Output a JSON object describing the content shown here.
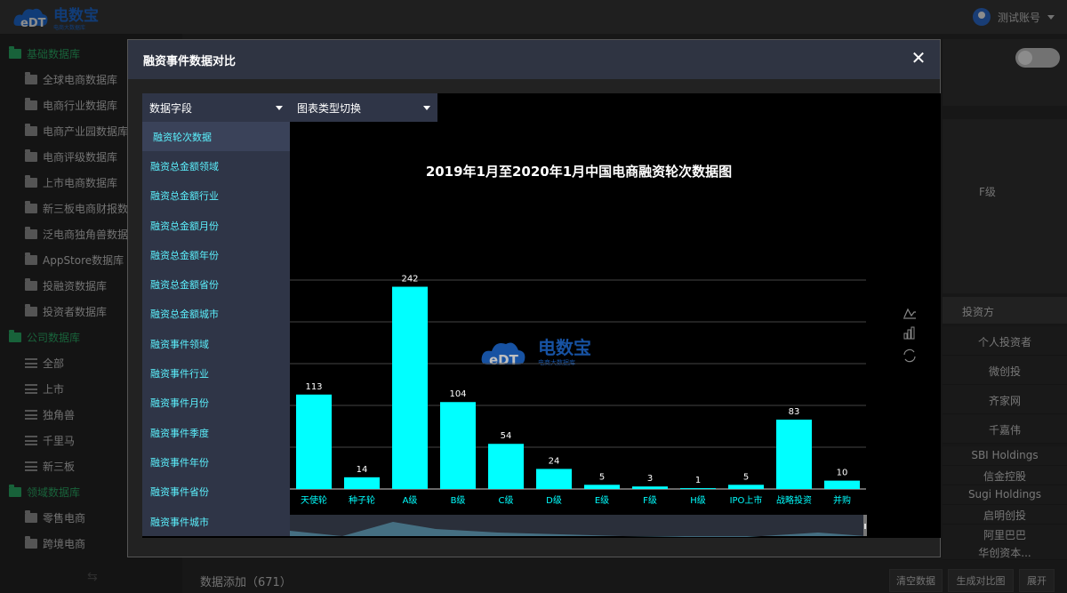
{
  "header": {
    "logo_main": "电数宝",
    "logo_sub": "电商大数据库",
    "user_name": "测试账号"
  },
  "sidebar": {
    "items": [
      {
        "label": "基础数据库",
        "kind": "cat",
        "icon": "folder-icon"
      },
      {
        "label": "全球电商数据库",
        "kind": "sub",
        "icon": "folder-icon"
      },
      {
        "label": "电商行业数据库",
        "kind": "sub",
        "icon": "folder-icon"
      },
      {
        "label": "电商产业园数据库",
        "kind": "sub",
        "icon": "folder-icon"
      },
      {
        "label": "电商评级数据库",
        "kind": "sub",
        "icon": "folder-icon"
      },
      {
        "label": "上市电商数据库",
        "kind": "sub",
        "icon": "folder-icon"
      },
      {
        "label": "新三板电商财报数",
        "kind": "sub",
        "icon": "folder-icon"
      },
      {
        "label": "泛电商独角兽数据",
        "kind": "sub",
        "icon": "folder-icon"
      },
      {
        "label": "AppStore数据库",
        "kind": "sub",
        "icon": "folder-icon"
      },
      {
        "label": "投融资数据库",
        "kind": "sub",
        "icon": "folder-icon"
      },
      {
        "label": "投资者数据库",
        "kind": "sub",
        "icon": "folder-icon"
      },
      {
        "label": "公司数据库",
        "kind": "cat",
        "icon": "folder-icon"
      },
      {
        "label": "全部",
        "kind": "sub",
        "icon": "list-icon"
      },
      {
        "label": "上市",
        "kind": "sub",
        "icon": "list-icon"
      },
      {
        "label": "独角兽",
        "kind": "sub",
        "icon": "list-icon"
      },
      {
        "label": "千里马",
        "kind": "sub",
        "icon": "list-icon"
      },
      {
        "label": "新三板",
        "kind": "sub",
        "icon": "list-icon"
      },
      {
        "label": "领域数据库",
        "kind": "cat",
        "icon": "folder-icon"
      },
      {
        "label": "零售电商",
        "kind": "sub",
        "icon": "folder-icon"
      },
      {
        "label": "跨境电商",
        "kind": "sub",
        "icon": "folder-icon"
      }
    ],
    "collapse_glyph": "⇆"
  },
  "right_panel": {
    "f_level": "F级",
    "investor_header": "投资方",
    "investors": [
      "个人投资者",
      "微创投",
      "齐家网",
      "千嘉伟",
      "SBI Holdings",
      "信金控股",
      "Sugi Holdings",
      "启明创投",
      "阿里巴巴",
      "华创资本..."
    ]
  },
  "bottom_bar": {
    "data_add": "数据添加（671）",
    "clear_button": "清空数据",
    "compare_button": "生成对比图",
    "expand_button": "展开"
  },
  "modal": {
    "title": "融资事件数据对比",
    "close_glyph": "✕",
    "field_dropdown": "数据字段",
    "charttype_dropdown": "图表类型切换",
    "menu_items": [
      "融资轮次数据",
      "融资总金额领域",
      "融资总金额行业",
      "融资总金额月份",
      "融资总金额年份",
      "融资总金额省份",
      "融资总金额城市",
      "融资事件领域",
      "融资事件行业",
      "融资事件月份",
      "融资事件季度",
      "融资事件年份",
      "融资事件省份",
      "融资事件城市"
    ],
    "active_menu_index": 0
  },
  "chart_data": {
    "type": "bar",
    "title": "2019年1月至2020年1月中国电商融资轮次数据图",
    "categories": [
      "天使轮",
      "种子轮",
      "A级",
      "B级",
      "C级",
      "D级",
      "E级",
      "F级",
      "H级",
      "IPO上市",
      "战略投资",
      "并购"
    ],
    "values": [
      113,
      14,
      242,
      104,
      54,
      24,
      5,
      3,
      1,
      5,
      83,
      10
    ],
    "xlabel": "",
    "ylabel": "",
    "ylim": [
      0,
      250
    ],
    "grid": true,
    "bar_color": "#00ffff",
    "label_color": "#ffffff",
    "axis_label_color": "#00ffff",
    "watermark_main": "电数宝",
    "watermark_sub": "电商大数据库",
    "has_datazoom_slider": true,
    "toolbox_icons": [
      "line-chart-icon",
      "bar-chart-icon",
      "refresh-icon"
    ]
  }
}
